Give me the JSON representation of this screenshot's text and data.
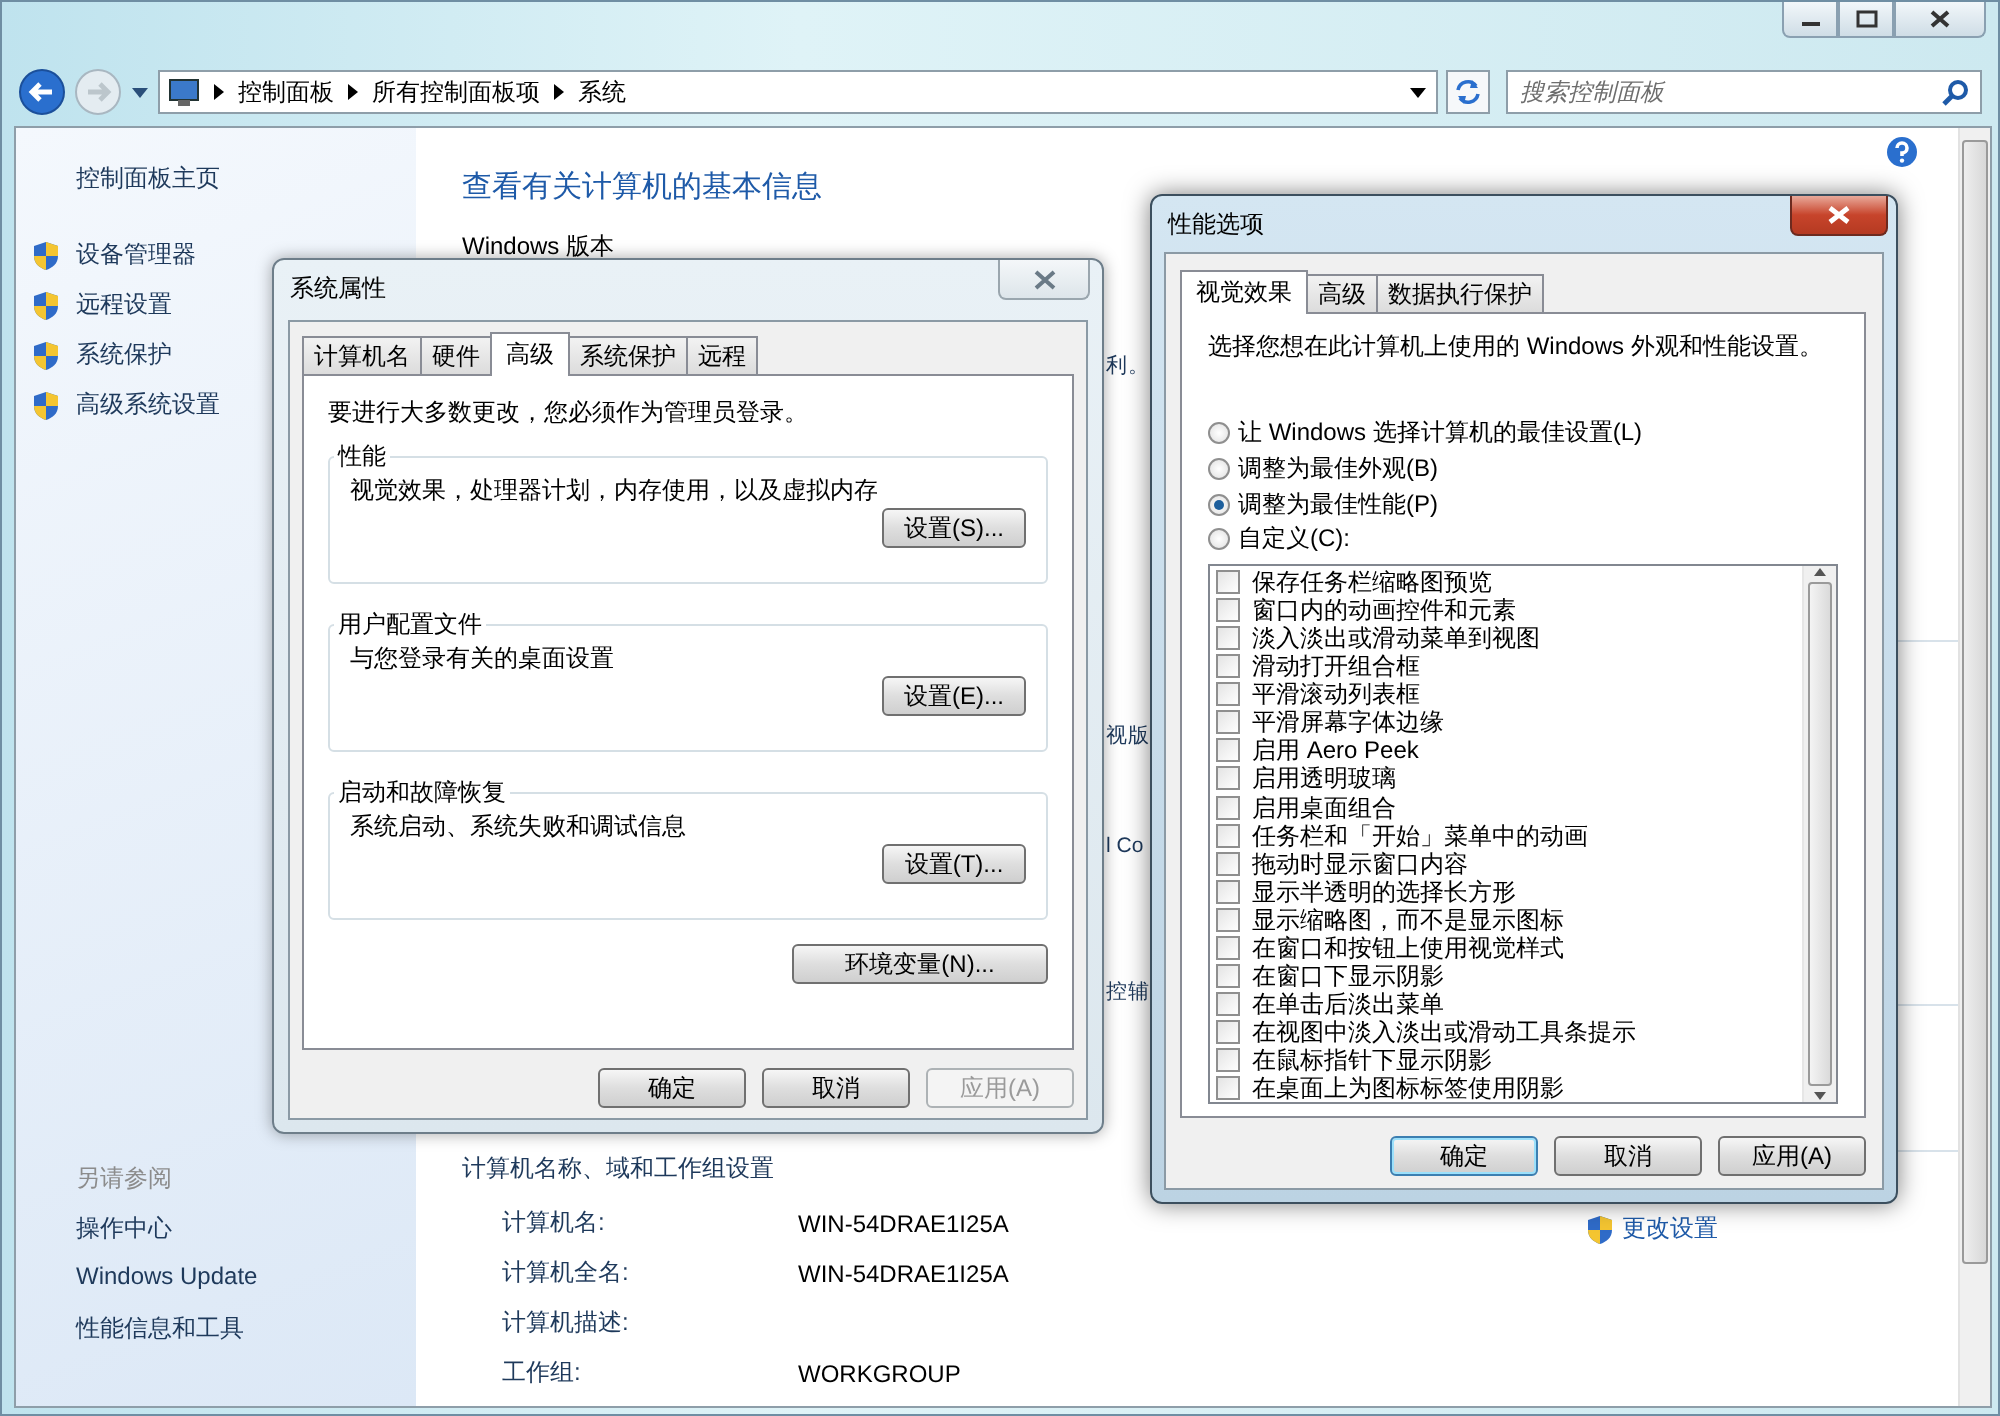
{
  "window": {
    "address_path": [
      "控制面板",
      "所有控制面板项",
      "系统"
    ],
    "search": {
      "placeholder": "搜索控制面板"
    }
  },
  "sidebar": {
    "home": "控制面板主页",
    "tasks": [
      "设备管理器",
      "远程设置",
      "系统保护",
      "高级系统设置"
    ],
    "see_also_heading": "另请参阅",
    "see_also": [
      "操作中心",
      "Windows Update",
      "性能信息和工具"
    ]
  },
  "main": {
    "title": "查看有关计算机的基本信息",
    "section": "Windows 版本",
    "fragments": [
      "利。",
      "视版",
      "l Co",
      "控辅"
    ],
    "computer_section": {
      "heading": "计算机名称、域和工作组设置",
      "change_link": "更改设置",
      "rows": [
        {
          "label": "计算机名:",
          "value": "WIN-54DRAE1I25A"
        },
        {
          "label": "计算机全名:",
          "value": "WIN-54DRAE1I25A"
        },
        {
          "label": "计算机描述:",
          "value": ""
        },
        {
          "label": "工作组:",
          "value": "WORKGROUP"
        }
      ]
    }
  },
  "system_properties": {
    "title": "系统属性",
    "tabs": [
      {
        "label": "计算机名",
        "selected": false
      },
      {
        "label": "硬件",
        "selected": false
      },
      {
        "label": "高级",
        "selected": true
      },
      {
        "label": "系统保护",
        "selected": false
      },
      {
        "label": "远程",
        "selected": false
      }
    ],
    "admin_note": "要进行大多数更改，您必须作为管理员登录。",
    "groups": [
      {
        "title": "性能",
        "description": "视觉效果，处理器计划，内存使用，以及虚拟内存",
        "button": "设置(S)..."
      },
      {
        "title": "用户配置文件",
        "description": "与您登录有关的桌面设置",
        "button": "设置(E)..."
      },
      {
        "title": "启动和故障恢复",
        "description": "系统启动、系统失败和调试信息",
        "button": "设置(T)..."
      }
    ],
    "env_button": "环境变量(N)...",
    "buttons": [
      {
        "label": "确定",
        "disabled": false
      },
      {
        "label": "取消",
        "disabled": false
      },
      {
        "label": "应用(A)",
        "disabled": true
      }
    ]
  },
  "performance_options": {
    "title": "性能选项",
    "tabs": [
      {
        "label": "视觉效果",
        "selected": true
      },
      {
        "label": "高级",
        "selected": false
      },
      {
        "label": "数据执行保护",
        "selected": false
      }
    ],
    "intro": "选择您想在此计算机上使用的 Windows 外观和性能设置。",
    "options": [
      {
        "label": "让 Windows 选择计算机的最佳设置(L)",
        "selected": false
      },
      {
        "label": "调整为最佳外观(B)",
        "selected": false
      },
      {
        "label": "调整为最佳性能(P)",
        "selected": true
      },
      {
        "label": "自定义(C):",
        "selected": false
      }
    ],
    "effects": [
      {
        "label": "保存任务栏缩略图预览",
        "checked": false
      },
      {
        "label": "窗口内的动画控件和元素",
        "checked": false
      },
      {
        "label": "淡入淡出或滑动菜单到视图",
        "checked": false
      },
      {
        "label": "滑动打开组合框",
        "checked": false
      },
      {
        "label": "平滑滚动列表框",
        "checked": false
      },
      {
        "label": "平滑屏幕字体边缘",
        "checked": false
      },
      {
        "label": "启用 Aero Peek",
        "checked": false
      },
      {
        "label": "启用透明玻璃",
        "checked": false
      },
      {
        "label": "启用桌面组合",
        "checked": false
      },
      {
        "label": "任务栏和「开始」菜单中的动画",
        "checked": false
      },
      {
        "label": "拖动时显示窗口内容",
        "checked": false
      },
      {
        "label": "显示半透明的选择长方形",
        "checked": false
      },
      {
        "label": "显示缩略图，而不是显示图标",
        "checked": false
      },
      {
        "label": "在窗口和按钮上使用视觉样式",
        "checked": false
      },
      {
        "label": "在窗口下显示阴影",
        "checked": false
      },
      {
        "label": "在单击后淡出菜单",
        "checked": false
      },
      {
        "label": "在视图中淡入淡出或滑动工具条提示",
        "checked": false
      },
      {
        "label": "在鼠标指针下显示阴影",
        "checked": false
      },
      {
        "label": "在桌面上为图标标签使用阴影",
        "checked": false
      }
    ],
    "buttons": [
      {
        "label": "确定",
        "default": true
      },
      {
        "label": "取消",
        "default": false
      },
      {
        "label": "应用(A)",
        "default": false
      }
    ]
  }
}
